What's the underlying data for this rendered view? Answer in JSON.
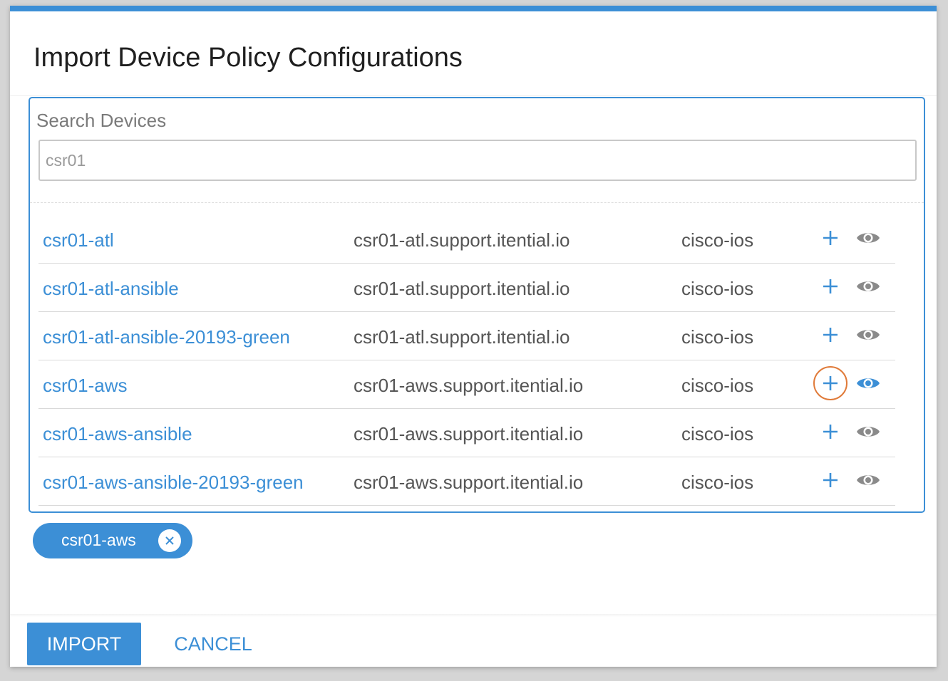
{
  "dialog": {
    "title": "Import Device Policy Configurations"
  },
  "search": {
    "label": "Search Devices",
    "value": "csr01"
  },
  "devices": [
    {
      "name": "csr01-atl",
      "host": "csr01-atl.support.itential.io",
      "os": "cisco-ios"
    },
    {
      "name": "csr01-atl-ansible",
      "host": "csr01-atl.support.itential.io",
      "os": "cisco-ios"
    },
    {
      "name": "csr01-atl-ansible-20193-green",
      "host": "csr01-atl.support.itential.io",
      "os": "cisco-ios"
    },
    {
      "name": "csr01-aws",
      "host": "csr01-aws.support.itential.io",
      "os": "cisco-ios"
    },
    {
      "name": "csr01-aws-ansible",
      "host": "csr01-aws.support.itential.io",
      "os": "cisco-ios"
    },
    {
      "name": "csr01-aws-ansible-20193-green",
      "host": "csr01-aws.support.itential.io",
      "os": "cisco-ios"
    }
  ],
  "row_icons": {
    "add": "plus-icon",
    "view": "eye-icon"
  },
  "selected": [
    {
      "label": "csr01-aws",
      "remove_icon": "close-icon"
    }
  ],
  "footer": {
    "import_label": "IMPORT",
    "cancel_label": "CANCEL"
  },
  "colors": {
    "accent": "#3c8fd6",
    "focus_ring": "#e07b3a",
    "text_muted": "#555555",
    "eye_inactive": "#8a8a8a"
  }
}
